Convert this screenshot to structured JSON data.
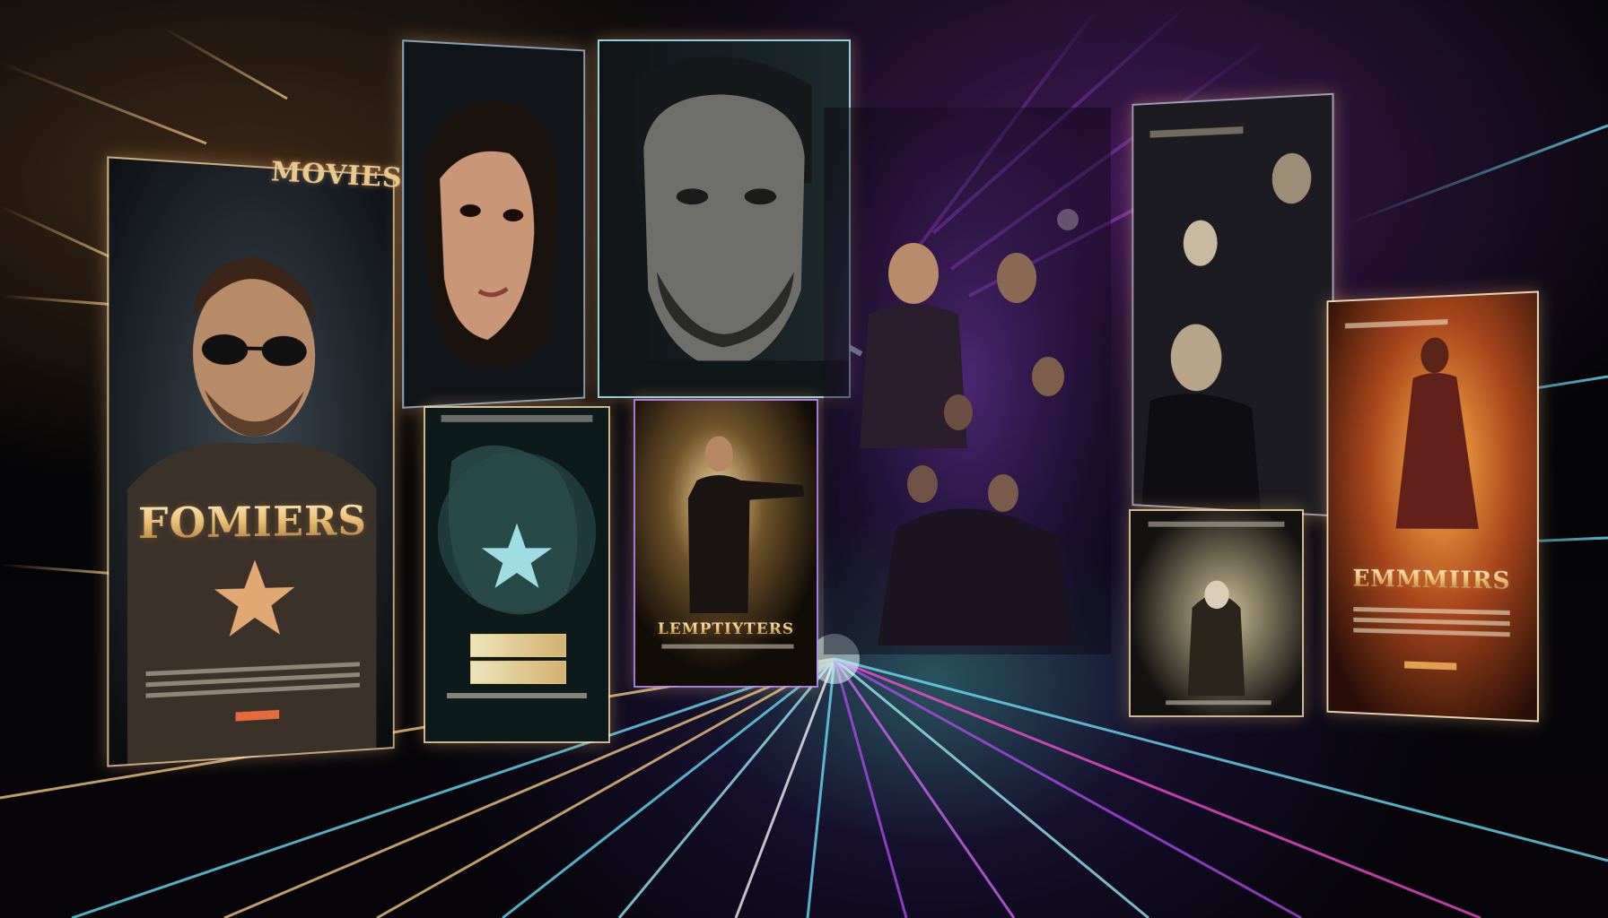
{
  "scene": {
    "label": "MOVIES",
    "accent_colors": {
      "gold": "#e9c27a",
      "cyan": "#6fe6ff",
      "purple": "#b24cf0",
      "magenta": "#ff4fd8"
    }
  },
  "posters": {
    "left": {
      "title": "FOMIERS"
    },
    "center": {
      "title": "LEMPTIYTERS"
    },
    "right": {
      "title": "EMMMIIRS"
    }
  }
}
